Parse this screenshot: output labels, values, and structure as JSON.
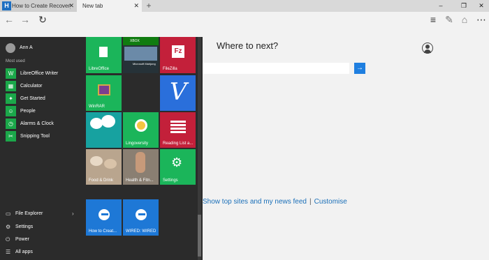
{
  "tabs": [
    {
      "label": "How to Create Recovery Par"
    },
    {
      "label": "New tab"
    }
  ],
  "window_controls": {
    "minimize": "–",
    "restore": "❐",
    "close": "✕"
  },
  "main": {
    "heading": "Where to next?",
    "topsites_link": "Show top sites and my news feed",
    "customise_link": "Customise"
  },
  "start_menu": {
    "user_name": "Ann A",
    "most_used_label": "Most used",
    "apps": [
      {
        "label": "LibreOffice Writer"
      },
      {
        "label": "Calculator"
      },
      {
        "label": "Get Started"
      },
      {
        "label": "People"
      },
      {
        "label": "Alarms & Clock"
      },
      {
        "label": "Snipping Tool"
      }
    ],
    "bottom": [
      {
        "label": "File Explorer"
      },
      {
        "label": "Settings"
      },
      {
        "label": "Power"
      },
      {
        "label": "All apps"
      }
    ],
    "tiles": {
      "libreoffice": "LibreOffice",
      "xbox_badge": "XBOX",
      "mahjong": "Microsoft Mahjong",
      "filezilla": "FileZilla",
      "winrar": "WinRAR",
      "lingoversity": "Lingoversity",
      "reading_list": "Reading List a...",
      "food": "Food & Drink",
      "health": "Health & Fitn...",
      "settings": "Settings",
      "how_to": "How to Creat...",
      "wired": "WIRED: WIRED"
    }
  },
  "colors": {
    "accent_green": "#1bb55a",
    "accent_blue": "#2a6fdb",
    "crimson": "#c3203a",
    "link": "#1a6fb8"
  }
}
